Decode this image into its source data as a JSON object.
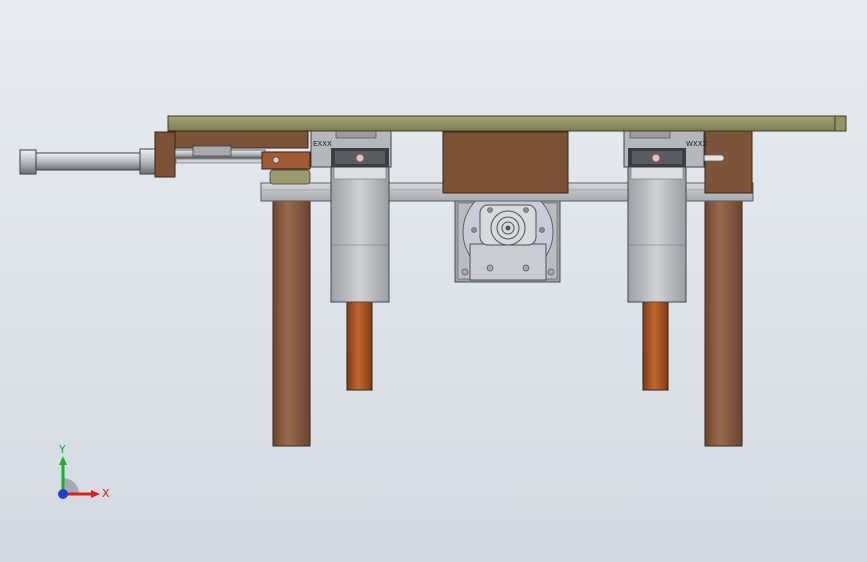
{
  "viewport": {
    "background_top": "#e8ecf1",
    "background_bottom": "#d3d9e0"
  },
  "model": {
    "components": [
      "top-plate",
      "frame-rail",
      "air-cylinder",
      "linear-guide-left",
      "linear-guide-right",
      "slide-block-left",
      "slide-block-right",
      "center-block",
      "motor-mount",
      "motor-flange",
      "support-leg-left",
      "support-leg-right",
      "piston-rod-left",
      "piston-rod-right",
      "end-stop-block"
    ],
    "colors": {
      "plate": "#8a8a5e",
      "frame": "#b9bcc0",
      "wood": "#8b5a3c",
      "rod": "#a0582a",
      "steel": "#c9ccd1",
      "dark_steel": "#6f7378",
      "red_mark": "#c0392b"
    },
    "guide_labels": {
      "left_block": "EXXX",
      "right_block": "WXXX"
    }
  },
  "triad": {
    "x_label": "X",
    "y_label": "Y",
    "x_color": "#d91f1f",
    "y_color": "#1fae2a",
    "z_color": "#2040d0"
  }
}
